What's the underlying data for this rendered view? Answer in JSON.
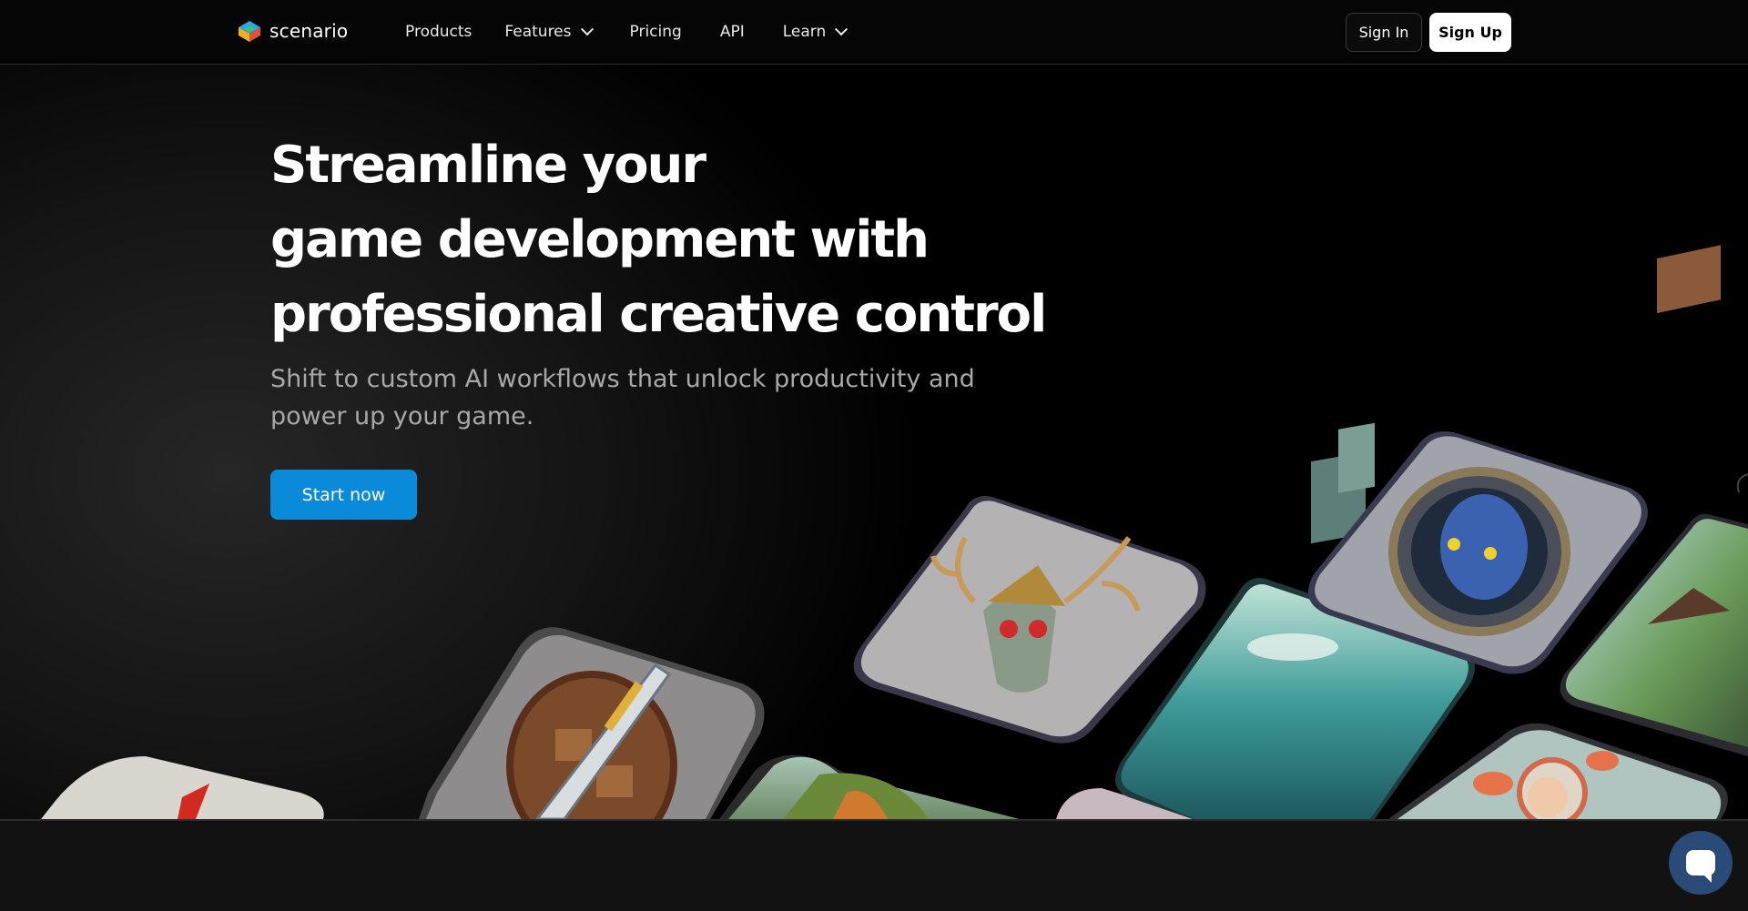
{
  "brand": {
    "name": "scenario"
  },
  "nav": {
    "items": [
      {
        "label": "Products",
        "has_dropdown": false
      },
      {
        "label": "Features",
        "has_dropdown": true
      },
      {
        "label": "Pricing",
        "has_dropdown": false
      },
      {
        "label": "API",
        "has_dropdown": false
      },
      {
        "label": "Learn",
        "has_dropdown": true
      }
    ],
    "sign_in": "Sign In",
    "sign_up": "Sign Up"
  },
  "hero": {
    "headline_lines": [
      "Streamline your",
      "game development with",
      "professional creative control"
    ],
    "subhead": "Shift to custom AI workflows that unlock productivity and power up your game.",
    "cta": "Start now"
  },
  "tiles": [
    {
      "name": "tile-red-gem-icon",
      "subject": "red gem"
    },
    {
      "name": "tile-pixel-sword-shield-icon",
      "subject": "pixel sword and shield"
    },
    {
      "name": "tile-forest-island-icon",
      "subject": "forest island"
    },
    {
      "name": "tile-antler-skull-helmet-icon",
      "subject": "antler skull helmet"
    },
    {
      "name": "tile-flooded-city-icon",
      "subject": "flooded city landscape"
    },
    {
      "name": "tile-blue-alien-portrait-icon",
      "subject": "blue alien portrait"
    },
    {
      "name": "tile-village-house-icon",
      "subject": "village house"
    },
    {
      "name": "tile-kid-with-fish-icon",
      "subject": "kid with flying fish"
    }
  ],
  "colors": {
    "accent": "#0a8ad8",
    "background": "#000000",
    "chat_button": "#2a4a78"
  }
}
